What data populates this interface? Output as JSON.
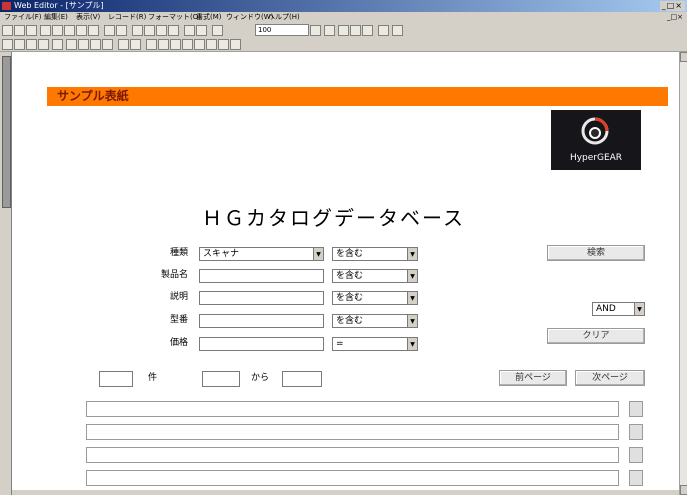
{
  "window": {
    "title": "Web Editor - [サンプル]",
    "controls": "_□×"
  },
  "menubar": {
    "items": [
      "ファイル(F)",
      "編集(E)",
      "表示(V)",
      "レコード(R)",
      "フォーマット(O)",
      "書式(M)",
      "ウィンドウ(W)",
      "ヘルプ(H)"
    ],
    "doc_controls": "_□×"
  },
  "toolbar": {
    "zoom_value": "100"
  },
  "banner": {
    "text": "サンプル表紙"
  },
  "logo": {
    "text": "HyperGEAR"
  },
  "main_title": "ＨＧカタログデータベース",
  "form": {
    "rows": [
      {
        "label": "種類",
        "value": "スキャナ",
        "op": "を含む"
      },
      {
        "label": "製品名",
        "value": "",
        "op": "を含む"
      },
      {
        "label": "説明",
        "value": "",
        "op": "を含む"
      },
      {
        "label": "型番",
        "value": "",
        "op": "を含む"
      },
      {
        "label": "価格",
        "value": "",
        "op": "="
      }
    ],
    "search_button": "検索",
    "logic_select": "AND",
    "clear_button": "クリア"
  },
  "paging": {
    "count_value": "",
    "count_unit": "件",
    "from_value": "",
    "from_label": "から",
    "to_value": "",
    "prev_button": "前ページ",
    "next_button": "次ページ"
  },
  "results": {
    "row_count": 4
  },
  "colors": {
    "banner": "#ff7800",
    "logo_bg": "#15151a",
    "titlebar": "#0a246a"
  }
}
